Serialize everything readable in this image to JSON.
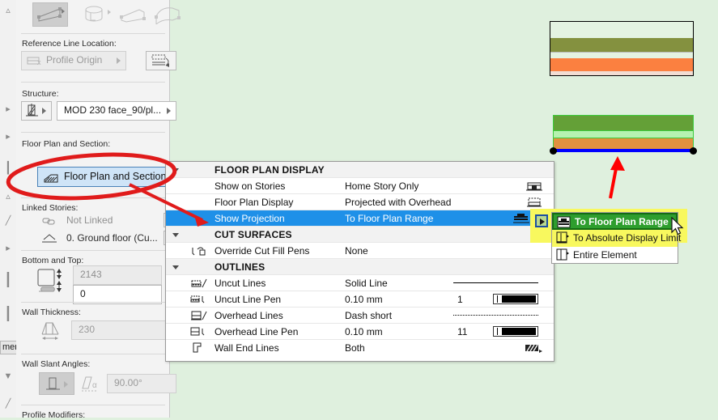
{
  "app": {
    "background_color": "#dff0de",
    "accent_selected": "#1e90e8",
    "highlight_yellow": "#f8f85e",
    "menu_highlight_green": "#2e9e2e"
  },
  "edge_strip": {
    "tooltip_text": "mer",
    "icons": [
      "triangle-icon",
      "chevron-right-icon",
      "chevron-right-icon",
      "bar-icon",
      "triangle-icon",
      "parallelogram-icon",
      "chevron-right-icon",
      "bar-icon",
      "bar-icon",
      "hatch-icon",
      "line-icon"
    ]
  },
  "left_panel": {
    "toolbar": {
      "buttons": [
        {
          "name": "straight-wall-tool",
          "label": "Straight Wall",
          "selected": true
        },
        {
          "name": "curved-wall-tool",
          "label": "Curved Wall",
          "selected": false
        },
        {
          "name": "trapezoid-wall-tool",
          "label": "Trapezoid Wall",
          "selected": false
        },
        {
          "name": "polygon-wall-tool",
          "label": "Polygon Wall",
          "selected": false
        }
      ]
    },
    "reference_line": {
      "label": "Reference Line Location:",
      "value": "Profile Origin",
      "disabled": true
    },
    "structure": {
      "label": "Structure:",
      "value": "MOD 230 face_90/pl..."
    },
    "floor_plan_section": {
      "label": "Floor Plan and Section:",
      "value": "Floor Plan and Section..."
    },
    "linked_stories": {
      "label": "Linked Stories:",
      "row1": "Not Linked",
      "row2": "0. Ground floor (Cu..."
    },
    "bottom_and_top": {
      "label": "Bottom and Top:",
      "top_value": "2143",
      "bottom_value": "0"
    },
    "wall_thickness": {
      "label": "Wall Thickness:",
      "value": "230"
    },
    "wall_slant_angles": {
      "label": "Wall Slant Angles:",
      "value": "90.00°"
    },
    "profile_modifiers": {
      "label": "Profile Modifiers:"
    }
  },
  "dialog": {
    "rows": [
      {
        "type": "group",
        "label": "FLOOR PLAN DISPLAY",
        "value": "",
        "num": "",
        "icon": ""
      },
      {
        "type": "item",
        "label": "Show on Stories",
        "value": "Home Story Only",
        "num": "",
        "icon": "",
        "right_icon": "story-stack-icon"
      },
      {
        "type": "item",
        "label": "Floor Plan Display",
        "value": "Projected with Overhead",
        "num": "",
        "icon": "",
        "right_icon": "projected-overhead-icon"
      },
      {
        "type": "selected",
        "label": "Show Projection",
        "value": "To Floor Plan Range",
        "num": "",
        "icon": "",
        "right_icon": "floor-plan-range-icon"
      },
      {
        "type": "group",
        "label": "CUT SURFACES",
        "value": "",
        "num": "",
        "icon": ""
      },
      {
        "type": "item",
        "label": "Override Cut Fill Pens",
        "value": "None",
        "num": "",
        "icon": "pen-override-icon"
      },
      {
        "type": "group",
        "label": "OUTLINES",
        "value": "",
        "num": "",
        "icon": ""
      },
      {
        "type": "item",
        "label": "Uncut Lines",
        "value": "Solid Line",
        "num": "",
        "icon": "uncut-lines-icon",
        "line_style": "solid"
      },
      {
        "type": "item",
        "label": "Uncut Line Pen",
        "value": "0.10 mm",
        "num": "1",
        "icon": "uncut-pen-icon",
        "pen_swatch": true
      },
      {
        "type": "item",
        "label": "Overhead Lines",
        "value": "Dash short",
        "num": "",
        "icon": "overhead-lines-icon",
        "line_style": "dashed"
      },
      {
        "type": "item",
        "label": "Overhead Line Pen",
        "value": "0.10 mm",
        "num": "11",
        "icon": "overhead-pen-icon",
        "pen_swatch": true
      },
      {
        "type": "item",
        "label": "Wall End Lines",
        "value": "Both",
        "num": "",
        "icon": "wall-end-lines-icon",
        "right_icon": "hatch-both-icon"
      }
    ]
  },
  "dropdown": {
    "items": [
      {
        "label": "To Floor Plan Range",
        "state": "highlighted",
        "icon": "floor-plan-range-icon"
      },
      {
        "label": "To Absolute Display Limit",
        "state": "emphasis",
        "icon": "absolute-display-limit-icon"
      },
      {
        "label": "Entire Element",
        "state": "normal",
        "icon": "entire-element-icon"
      }
    ]
  },
  "previews": {
    "top": {
      "name": "section-preview",
      "bands": [
        {
          "color": "#e4f3e2",
          "height": 20
        },
        {
          "color": "#84913f",
          "height": 17
        },
        {
          "color": "#e4f3e2",
          "height": 8
        },
        {
          "color": "#fb8040",
          "height": 16
        },
        {
          "color": "#f2ddd3",
          "height": 5
        }
      ]
    },
    "bottom": {
      "name": "plan-preview",
      "bands": [
        {
          "color": "#64a037",
          "height": 20
        },
        {
          "color": "#b6f2b0",
          "height": 8
        },
        {
          "color": "#e2913f",
          "height": 13
        }
      ],
      "baseline_color": "#0000ff",
      "outline_color": "#3ccc3c"
    }
  },
  "annotations": {
    "ellipse_color": "#e01b1b",
    "arrow_color": "#ff0000",
    "ellipse_target": "Floor Plan and Section...",
    "arrow1_target": "Show Projection",
    "arrow2_target": "plan-preview"
  }
}
